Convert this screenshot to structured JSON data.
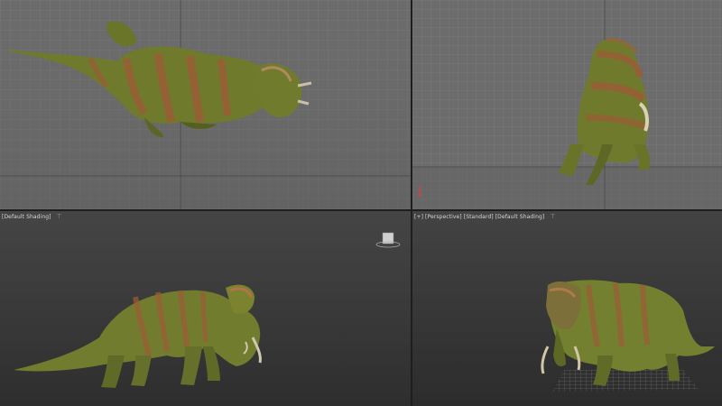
{
  "viewports": {
    "top": {
      "label": ""
    },
    "front": {
      "label": ""
    },
    "left": {
      "label": "[Default Shading]",
      "filter_icon": "filter-icon"
    },
    "perspective": {
      "label": "[+] [Perspective] [Standard] [Default Shading]",
      "filter_icon": "filter-icon",
      "active": true
    }
  },
  "colors": {
    "active_border": "#b8474f",
    "grid_light": "#7a7a7a",
    "grid_dark": "#585858",
    "skin_green": "#7b7f2e",
    "skin_stripe": "#a0603a"
  }
}
